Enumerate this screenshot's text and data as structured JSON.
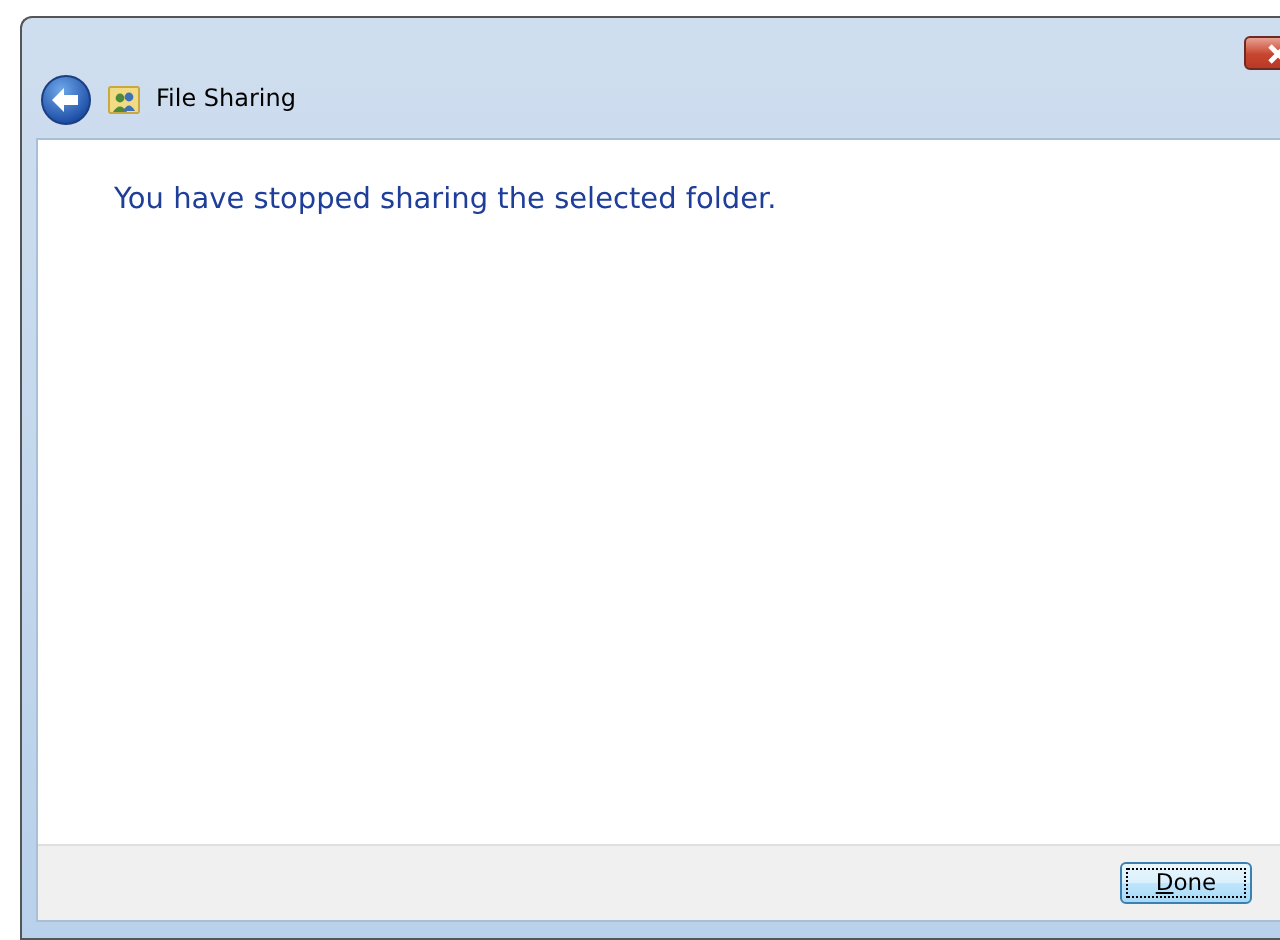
{
  "window": {
    "title": "File Sharing"
  },
  "message": "You have stopped sharing the selected folder.",
  "buttons": [
    {
      "label": "Done",
      "default": true
    }
  ]
}
